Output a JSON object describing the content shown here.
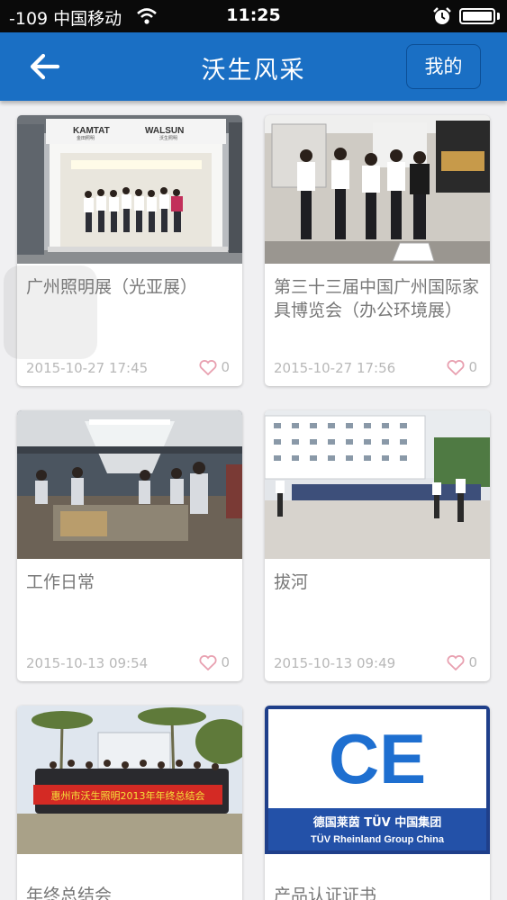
{
  "status_bar": {
    "signal": "-109 中国移动",
    "time": "11:25"
  },
  "nav": {
    "title": "沃生风采",
    "mine_label": "我的"
  },
  "colors": {
    "nav": "#1a6fc4",
    "like_heart": "#e8a0b0"
  },
  "posts": [
    {
      "title": "广州照明展（光亚展）",
      "date": "2015-10-27 17:45",
      "likes": "0",
      "photo_text": [
        "KAMTAT",
        "WALSUN",
        "金田照明",
        "沃生照明"
      ]
    },
    {
      "title": "第三十三届中国广州国际家具博览会（办公环境展）",
      "date": "2015-10-27 17:56",
      "likes": "0"
    },
    {
      "title": "工作日常",
      "date": "2015-10-13 09:54",
      "likes": "0"
    },
    {
      "title": "拔河",
      "date": "2015-10-13 09:49",
      "likes": "0"
    },
    {
      "title": "年终总结会",
      "date": "",
      "likes": "",
      "photo_text": [
        "惠州市沃生照明2013年年终总结会"
      ]
    },
    {
      "title": "产品认证证书",
      "date": "",
      "likes": "",
      "photo_text": [
        "德国莱茵 TÜV 中国集团",
        "TÜV Rheinland Group China"
      ]
    }
  ]
}
